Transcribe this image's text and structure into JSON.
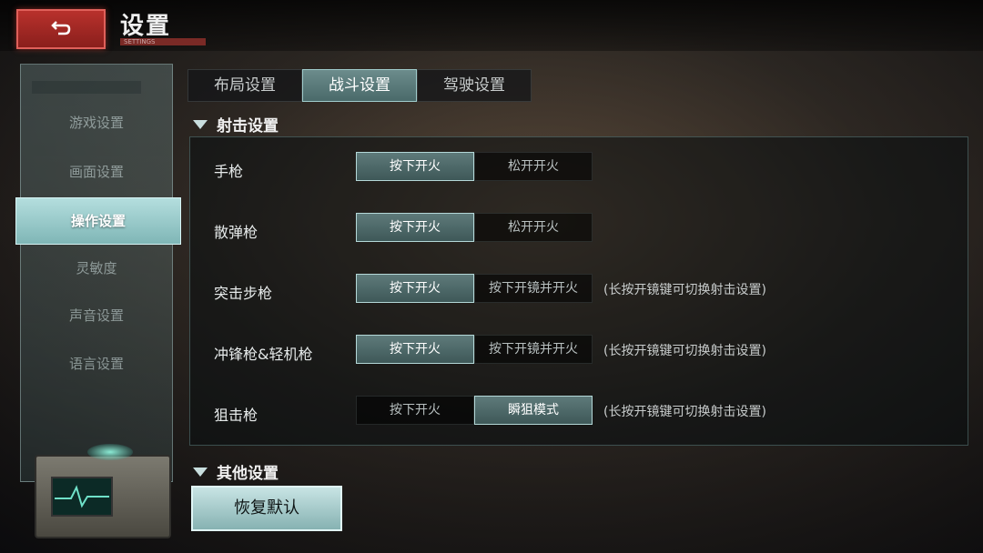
{
  "header": {
    "title": "设置",
    "subtitle": "SETTINGS"
  },
  "sidebar": {
    "items": [
      {
        "label": "游戏设置"
      },
      {
        "label": "画面设置"
      },
      {
        "label": "操作设置"
      },
      {
        "label": "灵敏度"
      },
      {
        "label": "声音设置"
      },
      {
        "label": "语言设置"
      }
    ],
    "active_index": 2
  },
  "tabs": [
    {
      "label": "布局设置"
    },
    {
      "label": "战斗设置"
    },
    {
      "label": "驾驶设置"
    }
  ],
  "active_tab": 1,
  "shooting": {
    "header": "射击设置",
    "rows": [
      {
        "label": "手枪",
        "option_a": "按下开火",
        "option_b": "松开开火",
        "selected": "a",
        "hint": ""
      },
      {
        "label": "散弹枪",
        "option_a": "按下开火",
        "option_b": "松开开火",
        "selected": "a",
        "hint": ""
      },
      {
        "label": "突击步枪",
        "option_a": "按下开火",
        "option_b": "按下开镜并开火",
        "selected": "a",
        "hint": "(长按开镜键可切换射击设置)"
      },
      {
        "label": "冲锋枪&轻机枪",
        "option_a": "按下开火",
        "option_b": "按下开镜并开火",
        "selected": "a",
        "hint": "(长按开镜键可切换射击设置)"
      },
      {
        "label": "狙击枪",
        "option_a": "按下开火",
        "option_b": "瞬狙模式",
        "selected": "b",
        "hint": "(长按开镜键可切换射击设置)"
      }
    ]
  },
  "other": {
    "header": "其他设置",
    "restore_label": "恢复默认"
  },
  "colors": {
    "accent": "#7fb6b6",
    "back_button": "#b8312c"
  },
  "icons": {
    "back": "return-arrow-icon",
    "section": "triangle-down-icon"
  }
}
